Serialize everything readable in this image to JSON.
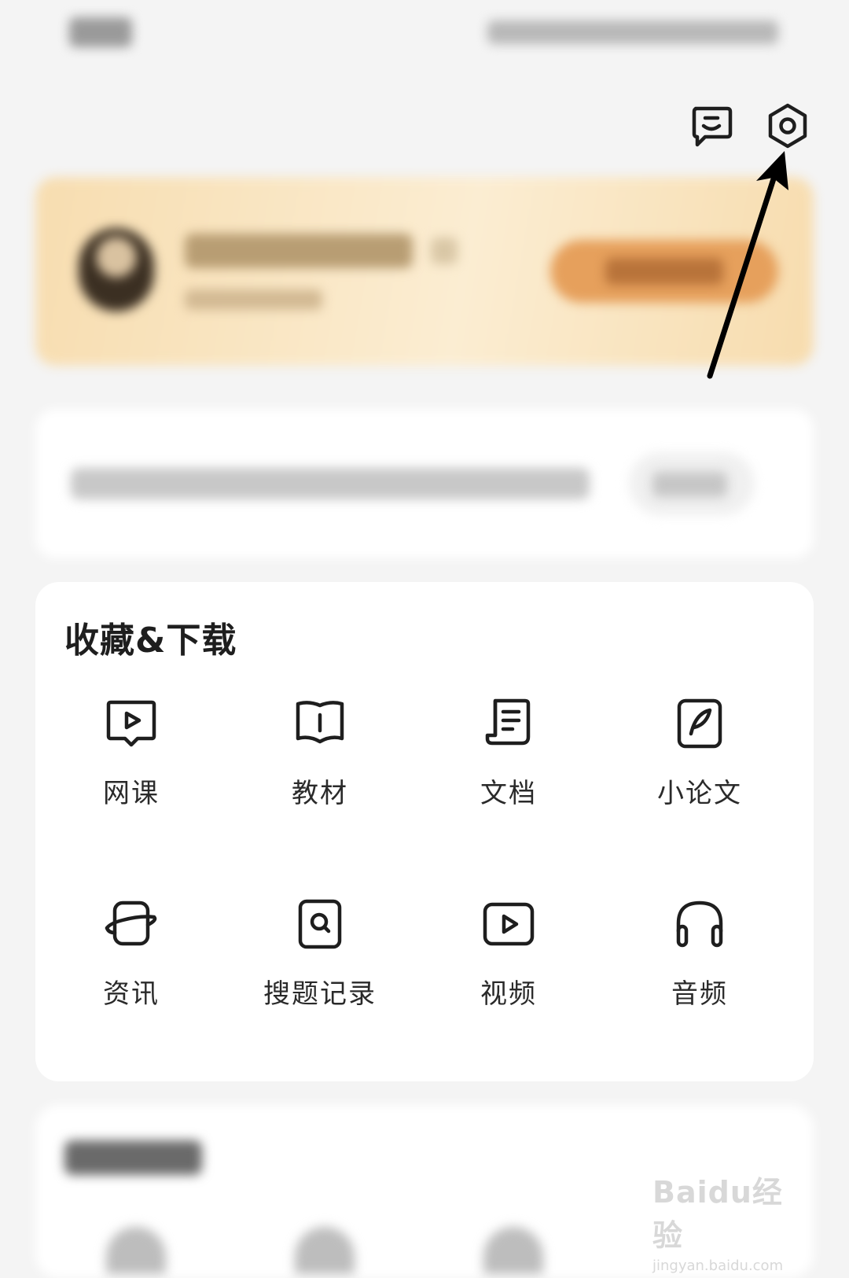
{
  "header": {
    "message_icon": "message-icon",
    "settings_icon": "settings-icon"
  },
  "favorites": {
    "title": "收藏&下载",
    "items": [
      {
        "label": "网课",
        "icon": "online-course-icon"
      },
      {
        "label": "教材",
        "icon": "textbook-icon"
      },
      {
        "label": "文档",
        "icon": "document-icon"
      },
      {
        "label": "小论文",
        "icon": "essay-icon"
      },
      {
        "label": "资讯",
        "icon": "news-icon"
      },
      {
        "label": "搜题记录",
        "icon": "search-record-icon"
      },
      {
        "label": "视频",
        "icon": "video-icon"
      },
      {
        "label": "音频",
        "icon": "audio-icon"
      }
    ]
  },
  "watermark": {
    "line1": "Baidu经验",
    "line2": "jingyan.baidu.com"
  },
  "colors": {
    "background": "#f4f4f4",
    "vip_gradient": "#f7ddb0",
    "vip_button": "#e6a05c",
    "icon_stroke": "#1e1e1e"
  }
}
